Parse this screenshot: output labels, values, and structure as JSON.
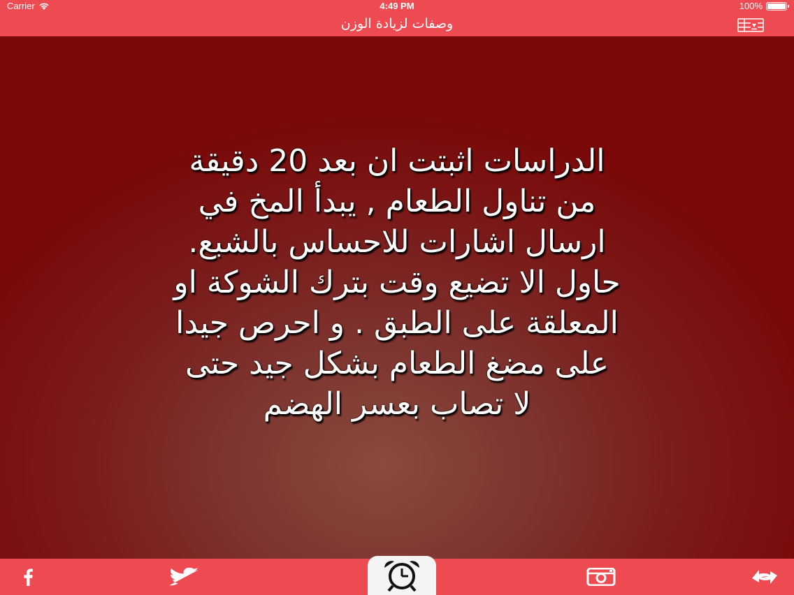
{
  "status_bar": {
    "carrier": "Carrier",
    "time": "4:49 PM",
    "battery": "100%"
  },
  "nav": {
    "title": "وصفات لزيادة الوزن",
    "menu_icon": "list-download-icon"
  },
  "content": {
    "tip_text": "الدراسات اثبتت ان بعد 20 دقيقة\nمن تناول الطعام , يبدأ المخ في\nارسال اشارات للاحساس بالشبع.\nحاول الا تضيع وقت بترك الشوكة او\nالمعلقة على الطبق . و احرص جيدا\nعلى مضغ الطعام بشكل جيد حتى\nلا تصاب بعسر الهضم"
  },
  "tab_bar": {
    "items": [
      {
        "icon": "facebook-icon"
      },
      {
        "icon": "twitter-icon"
      },
      {
        "icon": "alarm-clock-icon"
      },
      {
        "icon": "instagram-icon"
      },
      {
        "icon": "share-arrows-icon"
      }
    ]
  },
  "colors": {
    "bar": "#ee4a52",
    "background_dark": "#7a0707",
    "background_light": "#8a4a3c",
    "text": "#ffffff"
  }
}
